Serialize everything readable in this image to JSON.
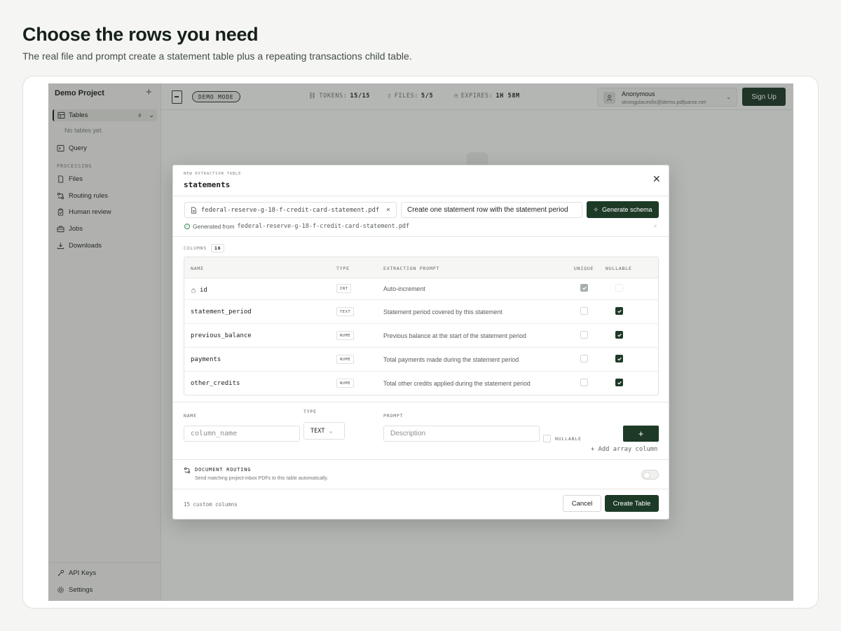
{
  "hero": {
    "title": "Choose the rows you need",
    "subtitle": "The real file and prompt create a statement table plus a repeating transactions child table."
  },
  "sidebar": {
    "project": "Demo Project",
    "add_icon": "plus-icon",
    "tables_label": "Tables",
    "tables_count": "0",
    "no_tables": "No tables yet.",
    "query_label": "Query",
    "processing_label": "PROCESSING",
    "processing_items": [
      {
        "label": "Files",
        "icon": "file-icon"
      },
      {
        "label": "Routing rules",
        "icon": "routing-icon"
      },
      {
        "label": "Human review",
        "icon": "clipboard-icon"
      },
      {
        "label": "Jobs",
        "icon": "briefcase-icon"
      },
      {
        "label": "Downloads",
        "icon": "download-icon"
      }
    ],
    "footer_items": [
      {
        "label": "API Keys",
        "icon": "key-icon"
      },
      {
        "label": "Settings",
        "icon": "gear-icon"
      }
    ]
  },
  "topbar": {
    "demo_mode": "DEMO MODE",
    "tokens_label": "TOKENS:",
    "tokens_value": "15/15",
    "files_label": "FILES:",
    "files_value": "5/5",
    "expires_label": "EXPIRES:",
    "expires_value": "1H 58M",
    "user_name": "Anonymous",
    "user_email": "strongplacesfix@demo.pdfparse.net",
    "signup": "Sign Up"
  },
  "modal": {
    "kicker": "NEW EXTRACTION TABLE",
    "title": "statements",
    "file_name": "federal-reserve-g-18-f-credit-card-statement.pdf",
    "prompt_value": "Create one statement row with the statement period",
    "generate_label": "Generate schema",
    "generated_note": "Generated from",
    "generated_file": "federal-reserve-g-18-f-credit-card-statement.pdf",
    "columns_label": "COLUMNS",
    "columns_count": "16",
    "headers": {
      "name": "NAME",
      "type": "TYPE",
      "prompt": "EXTRACTION PROMPT",
      "unique": "UNIQUE",
      "nullable": "NULLABLE"
    },
    "rows": [
      {
        "name": "id",
        "type": "INT",
        "prompt": "Auto-increment",
        "unique": true,
        "nullable": false,
        "locked": true
      },
      {
        "name": "statement_period",
        "type": "TEXT",
        "prompt": "Statement period covered by this statement",
        "unique": false,
        "nullable": true
      },
      {
        "name": "previous_balance",
        "type": "NUME",
        "prompt": "Previous balance at the start of the statement period",
        "unique": false,
        "nullable": true
      },
      {
        "name": "payments",
        "type": "NUME",
        "prompt": "Total payments made during the statement period",
        "unique": false,
        "nullable": true
      },
      {
        "name": "other_credits",
        "type": "NUME",
        "prompt": "Total other credits applied during the statement period",
        "unique": false,
        "nullable": true
      }
    ],
    "form": {
      "name_label": "NAME",
      "name_placeholder": "column_name",
      "type_label": "TYPE",
      "type_value": "TEXT",
      "prompt_label": "PROMPT",
      "prompt_placeholder": "Description",
      "nullable_label": "NULLABLE",
      "add_label": "+",
      "add_array": "+ Add array column"
    },
    "routing_title": "DOCUMENT ROUTING",
    "routing_sub": "Send matching project-inbox PDFs to this table automatically.",
    "custom_columns": "15 custom columns",
    "cancel": "Cancel",
    "create": "Create Table"
  }
}
